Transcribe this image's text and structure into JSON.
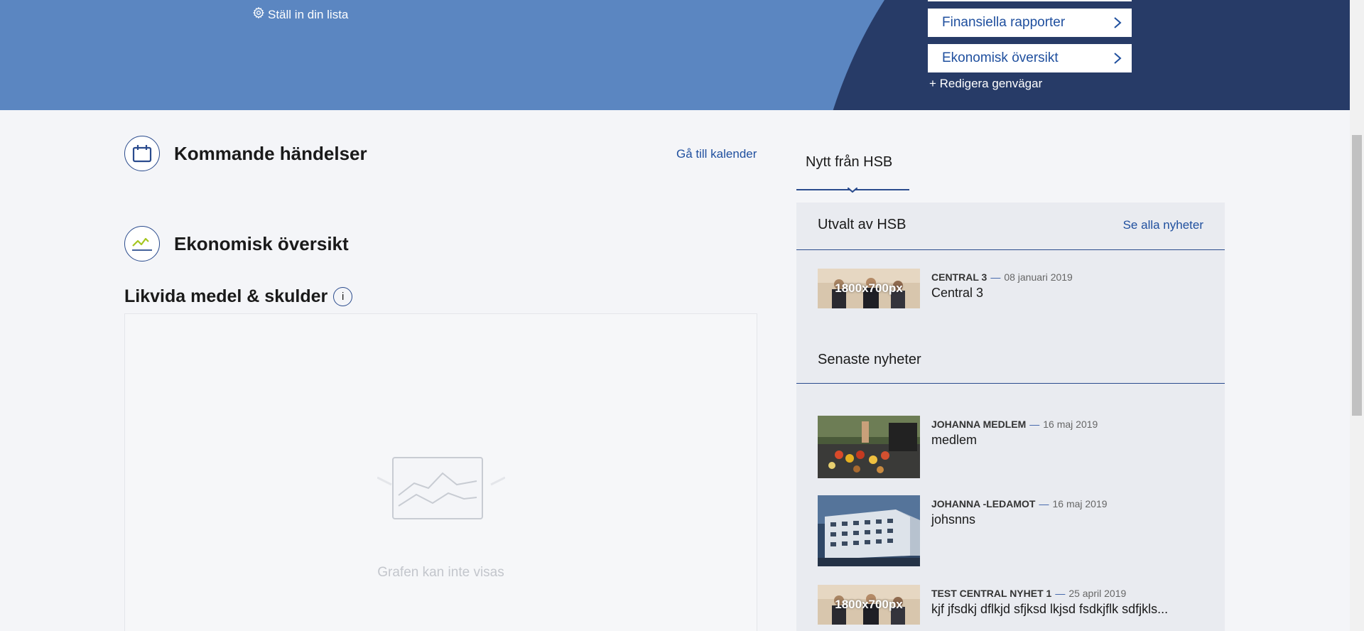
{
  "hero": {
    "settings_label": "Ställ in din lista",
    "shortcuts": [
      "Finansiella rapporter",
      "Ekonomisk översikt"
    ],
    "edit_shortcuts": "+ Redigera genvägar"
  },
  "events": {
    "title": "Kommande händelser",
    "calendar_link": "Gå till kalender"
  },
  "economy": {
    "title": "Ekonomisk översikt",
    "chart_title": "Likvida medel & skulder",
    "info_glyph": "i",
    "chart_message": "Grafen kan inte visas"
  },
  "news": {
    "tab": "Nytt från HSB",
    "selected": {
      "title": "Utvalt av HSB",
      "see_all": "Se alla nyheter",
      "items": [
        {
          "source": "CENTRAL 3",
          "date": "08 januari 2019",
          "title": "Central 3",
          "thumb_label": "1800x700px"
        }
      ]
    },
    "latest": {
      "title": "Senaste nyheter",
      "items": [
        {
          "source": "JOHANNA MEDLEM",
          "date": "16 maj 2019",
          "title": "medlem"
        },
        {
          "source": "JOHANNA -LEDAMOT",
          "date": "16 maj 2019",
          "title": "johsnns"
        },
        {
          "source": "TEST CENTRAL NYHET 1",
          "date": "25 april 2019",
          "title": "kjf jfsdkj dflkjd sfjksd lkjsd fsdkjflk sdfjkls...",
          "thumb_label": "1800x700px"
        }
      ]
    },
    "dash": "—"
  },
  "colors": {
    "hero_light": "#5b86c1",
    "hero_dark": "#273b67",
    "link": "#1f4f9e",
    "accent_green": "#a5c61f"
  }
}
